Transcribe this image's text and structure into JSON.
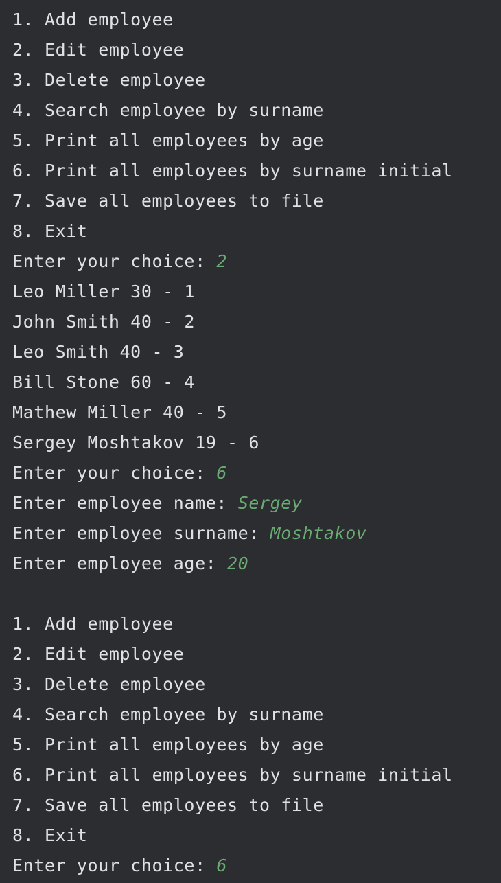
{
  "console": {
    "lines": [
      {
        "text": "1. Add employee",
        "input": ""
      },
      {
        "text": "2. Edit employee",
        "input": ""
      },
      {
        "text": "3. Delete employee",
        "input": ""
      },
      {
        "text": "4. Search employee by surname",
        "input": ""
      },
      {
        "text": "5. Print all employees by age",
        "input": ""
      },
      {
        "text": "6. Print all employees by surname initial",
        "input": ""
      },
      {
        "text": "7. Save all employees to file",
        "input": ""
      },
      {
        "text": "8. Exit",
        "input": ""
      },
      {
        "text": "Enter your choice: ",
        "input": "2"
      },
      {
        "text": "Leo Miller 30 - 1",
        "input": ""
      },
      {
        "text": "John Smith 40 - 2",
        "input": ""
      },
      {
        "text": "Leo Smith 40 - 3",
        "input": ""
      },
      {
        "text": "Bill Stone 60 - 4",
        "input": ""
      },
      {
        "text": "Mathew Miller 40 - 5",
        "input": ""
      },
      {
        "text": "Sergey Moshtakov 19 - 6",
        "input": ""
      },
      {
        "text": "Enter your choice: ",
        "input": "6"
      },
      {
        "text": "Enter employee name: ",
        "input": "Sergey"
      },
      {
        "text": "Enter employee surname: ",
        "input": "Moshtakov"
      },
      {
        "text": "Enter employee age: ",
        "input": "20"
      },
      {
        "text": "",
        "input": ""
      },
      {
        "text": "1. Add employee",
        "input": ""
      },
      {
        "text": "2. Edit employee",
        "input": ""
      },
      {
        "text": "3. Delete employee",
        "input": ""
      },
      {
        "text": "4. Search employee by surname",
        "input": ""
      },
      {
        "text": "5. Print all employees by age",
        "input": ""
      },
      {
        "text": "6. Print all employees by surname initial",
        "input": ""
      },
      {
        "text": "7. Save all employees to file",
        "input": ""
      },
      {
        "text": "8. Exit",
        "input": ""
      },
      {
        "text": "Enter your choice: ",
        "input": "6"
      }
    ]
  },
  "colors": {
    "background": "#2b2d30",
    "text": "#dfe1e5",
    "user_input": "#6aab73"
  }
}
